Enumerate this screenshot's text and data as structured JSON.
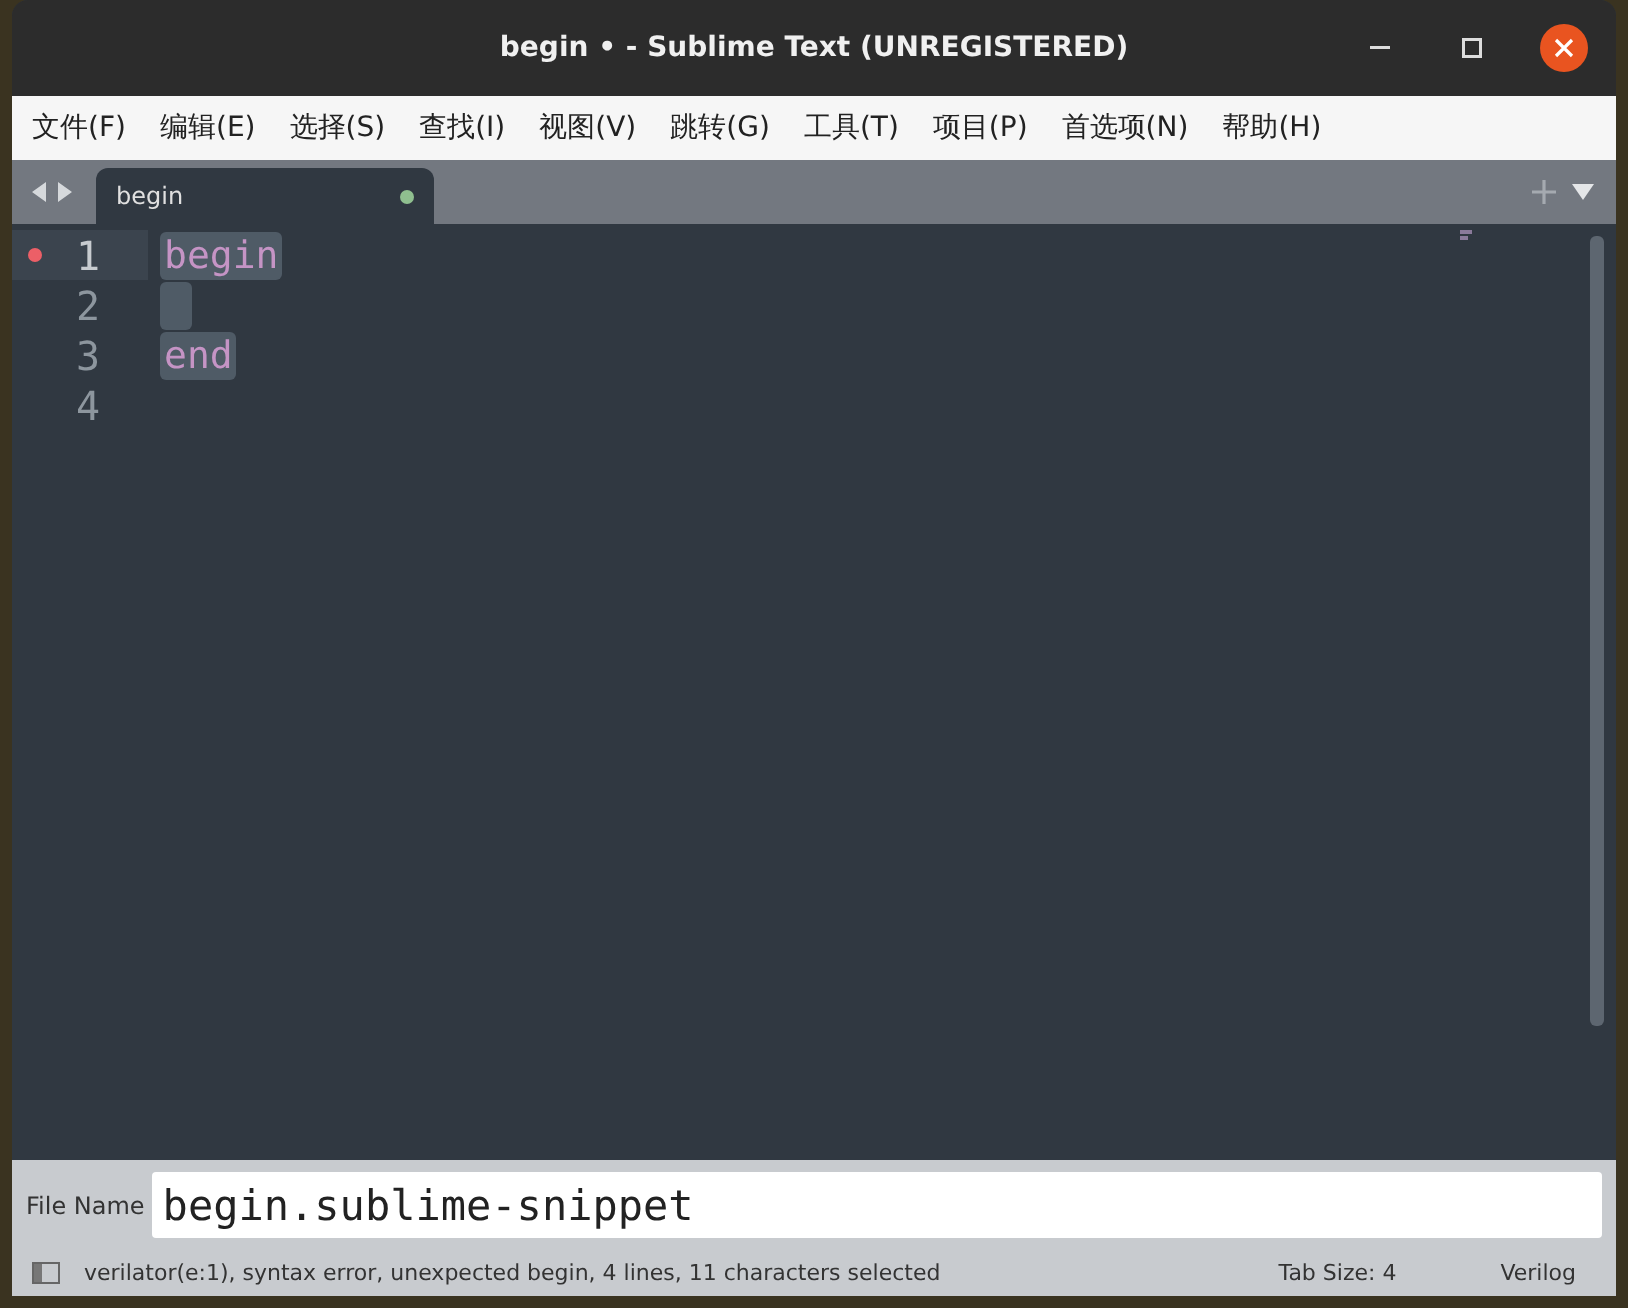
{
  "window": {
    "title": "begin • - Sublime Text (UNREGISTERED)"
  },
  "menu": [
    "文件(F)",
    "编辑(E)",
    "选择(S)",
    "查找(I)",
    "视图(V)",
    "跳转(G)",
    "工具(T)",
    "项目(P)",
    "首选项(N)",
    "帮助(H)"
  ],
  "tabs": [
    {
      "label": "begin",
      "selected": true,
      "modified": true
    }
  ],
  "lines": [
    {
      "number": "1",
      "text": "begin",
      "selected": true,
      "current": true,
      "error": true
    },
    {
      "number": "2",
      "selected": true,
      "current": false,
      "error": false
    },
    {
      "number": "3",
      "text": "end",
      "selected": true,
      "current": false,
      "error": false
    },
    {
      "number": "4",
      "selected": false,
      "current": false,
      "error": false
    }
  ],
  "input_panel": {
    "label": "File Name",
    "value": "begin.sublime-snippet"
  },
  "status_bar": {
    "message": "verilator(e:1), syntax error, unexpected begin, 4 lines, 11 characters selected",
    "tab_size": "Tab Size: 4",
    "syntax": "Verilog"
  }
}
